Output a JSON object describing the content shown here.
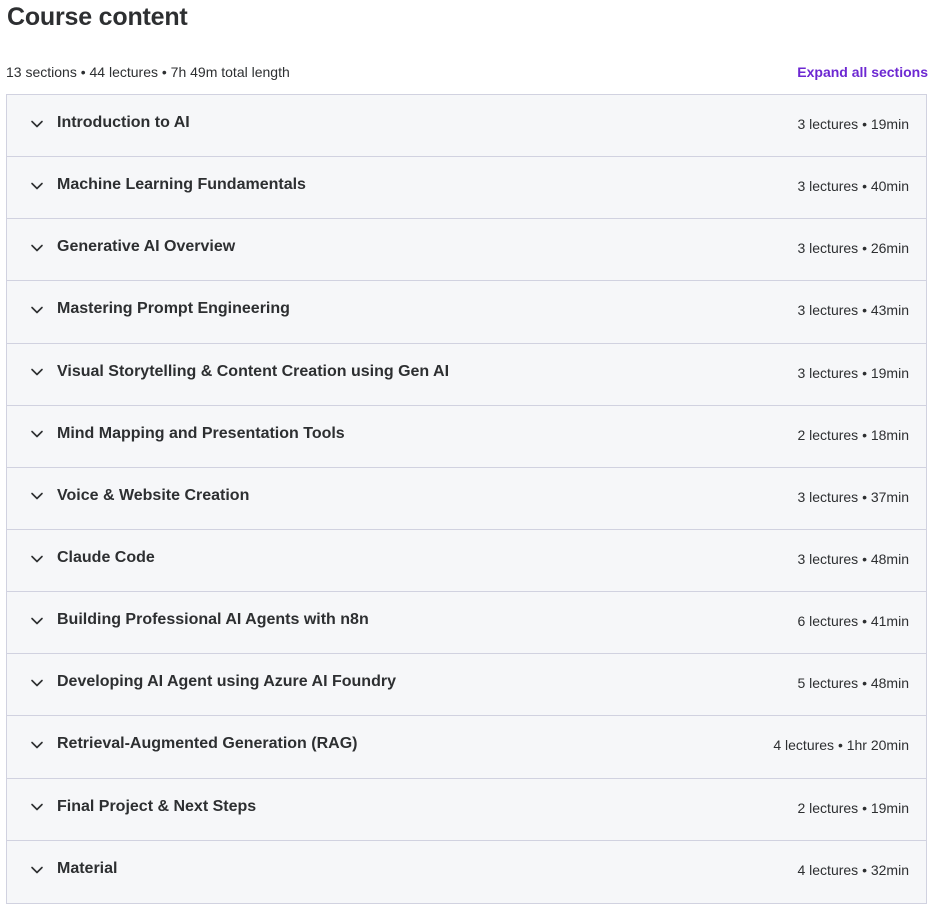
{
  "page_title": "Course content",
  "summary": "13 sections • 44 lectures • 7h 49m total length",
  "expand_all_label": "Expand all sections",
  "colors": {
    "accent": "#6d28d2",
    "text": "#2d2f31",
    "section_bg": "#f6f7f9",
    "border": "#d1d2e0"
  },
  "chevron_icon": "chevron-down-icon",
  "sections": [
    {
      "title": "Introduction to AI",
      "meta": "3 lectures • 19min"
    },
    {
      "title": "Machine Learning Fundamentals",
      "meta": "3 lectures • 40min"
    },
    {
      "title": "Generative AI Overview",
      "meta": "3 lectures • 26min"
    },
    {
      "title": "Mastering Prompt Engineering",
      "meta": "3 lectures • 43min"
    },
    {
      "title": "Visual Storytelling & Content Creation using Gen AI",
      "meta": "3 lectures • 19min"
    },
    {
      "title": "Mind Mapping and Presentation Tools",
      "meta": "2 lectures • 18min"
    },
    {
      "title": "Voice & Website Creation",
      "meta": "3 lectures • 37min"
    },
    {
      "title": "Claude Code",
      "meta": "3 lectures • 48min"
    },
    {
      "title": "Building Professional AI Agents with n8n",
      "meta": "6 lectures • 41min"
    },
    {
      "title": "Developing AI Agent using Azure AI Foundry",
      "meta": "5 lectures • 48min"
    },
    {
      "title": "Retrieval-Augmented Generation (RAG)",
      "meta": "4 lectures • 1hr 20min"
    },
    {
      "title": "Final Project & Next Steps",
      "meta": "2 lectures • 19min"
    },
    {
      "title": "Material",
      "meta": "4 lectures • 32min"
    }
  ]
}
